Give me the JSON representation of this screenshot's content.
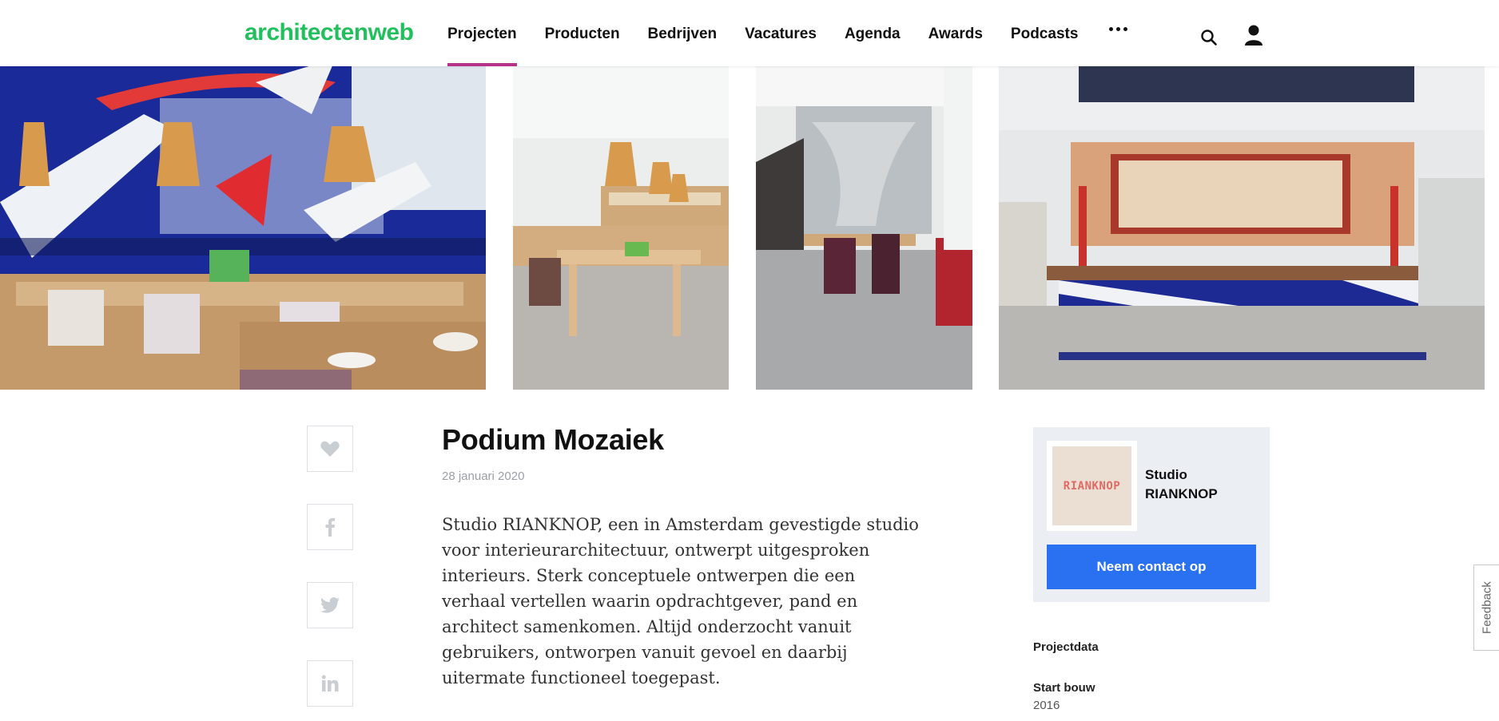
{
  "header": {
    "logo": "architectenweb",
    "nav": [
      "Projecten",
      "Producten",
      "Bedrijven",
      "Vacatures",
      "Agenda",
      "Awards",
      "Podcasts"
    ],
    "active_nav": "Projecten",
    "more_icon": "ellipsis-icon",
    "search_icon": "search-icon",
    "user_icon": "user-icon"
  },
  "gallery": {
    "photos": [
      "restaurant-interior-blue-tile-mural",
      "dining-room-pendant-lamps",
      "dining-room-glass-partition",
      "bar-counter-red-shelving"
    ]
  },
  "social": {
    "icons": [
      "heart-icon",
      "facebook-icon",
      "twitter-icon",
      "linkedin-icon"
    ]
  },
  "article": {
    "title": "Podium Mozaiek",
    "date": "28 januari 2020",
    "intro": "Studio RIANKNOP, een in Amsterdam gevestigde studio voor interieurarchitectuur, ontwerpt uitgesproken interieurs. Sterk conceptuele ontwerpen die een verhaal vertellen waarin opdrachtgever, pand en architect samenkomen. Altijd onderzocht vanuit gebruikers, ontworpen vanuit gevoel en daarbij uitermate functioneel toegepast."
  },
  "company_card": {
    "logo_text": "RIANKNOP",
    "name": "Studio RIANKNOP",
    "contact_label": "Neem contact op"
  },
  "project_data": {
    "heading": "Projectdata",
    "start_label": "Start bouw",
    "start_value": "2016"
  },
  "feedback_label": "Feedback",
  "colors": {
    "brand_green": "#22c05c",
    "active_underline": "#b5338a",
    "button_blue": "#2a71f2",
    "card_bg": "#ebeef2"
  }
}
